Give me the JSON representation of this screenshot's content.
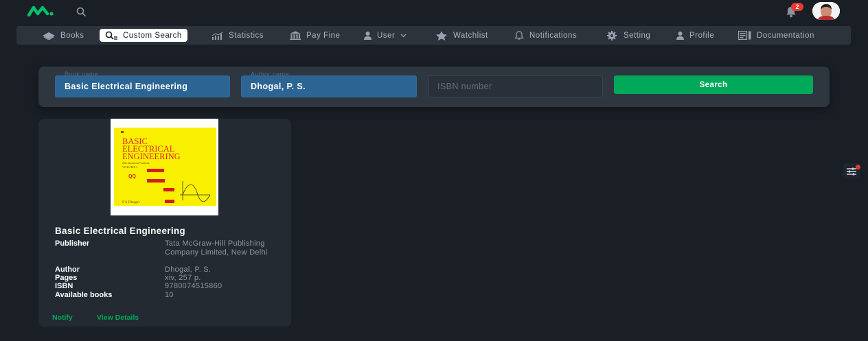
{
  "header": {
    "logo_icon": "brand-logo-icon",
    "search_icon": "search-icon",
    "notification_count": "2",
    "avatar_icon": "user-avatar"
  },
  "nav": {
    "items": [
      {
        "label": "Books",
        "icon": "books-icon"
      },
      {
        "label": "Custom Search",
        "icon": "search-icon",
        "active": true
      },
      {
        "label": "Statistics",
        "icon": "chart-icon"
      },
      {
        "label": "Pay Fine",
        "icon": "bank-icon"
      },
      {
        "label": "User",
        "icon": "user-icon",
        "dropdown": true
      },
      {
        "label": "Watchlist",
        "icon": "star-icon"
      },
      {
        "label": "Notifications",
        "icon": "bell-icon"
      },
      {
        "label": "Setting",
        "icon": "gear-icon"
      },
      {
        "label": "Profile",
        "icon": "profile-icon"
      },
      {
        "label": "Documentation",
        "icon": "document-icon"
      }
    ]
  },
  "search": {
    "book_name_label": "Book name",
    "book_name_value": "Basic Electrical Engineering",
    "author_name_label": "Author name",
    "author_name_value": "Dhogal, P. S.",
    "isbn_placeholder": "ISBN number",
    "button_label": "Search"
  },
  "result": {
    "title": "Basic Electrical Engineering",
    "publisher_label": "Publisher",
    "publisher": "Tata McGraw-Hill Publishing Company Limited, New Delhi",
    "author_label": "Author",
    "author": "Dhogal, P. S.",
    "pages_label": "Pages",
    "pages": "xiv, 257 p.",
    "isbn_label": "ISBN",
    "isbn": "9780074515860",
    "available_label": "Available books",
    "available": "10",
    "notify_label": "Notify",
    "details_label": "View Details",
    "cover": {
      "line1": "BASIC",
      "line2": "ELECTRICAL",
      "line3": "ENGINEERING",
      "subtitle": "With Numerical Problems",
      "volume": "VOLUME I",
      "author": "P S Dhogal"
    }
  },
  "colors": {
    "background": "#1a1f26",
    "accent_green": "#00a859",
    "field_blue": "#2c6593",
    "badge_red": "#e53935",
    "cover_yellow": "#f8f000"
  }
}
